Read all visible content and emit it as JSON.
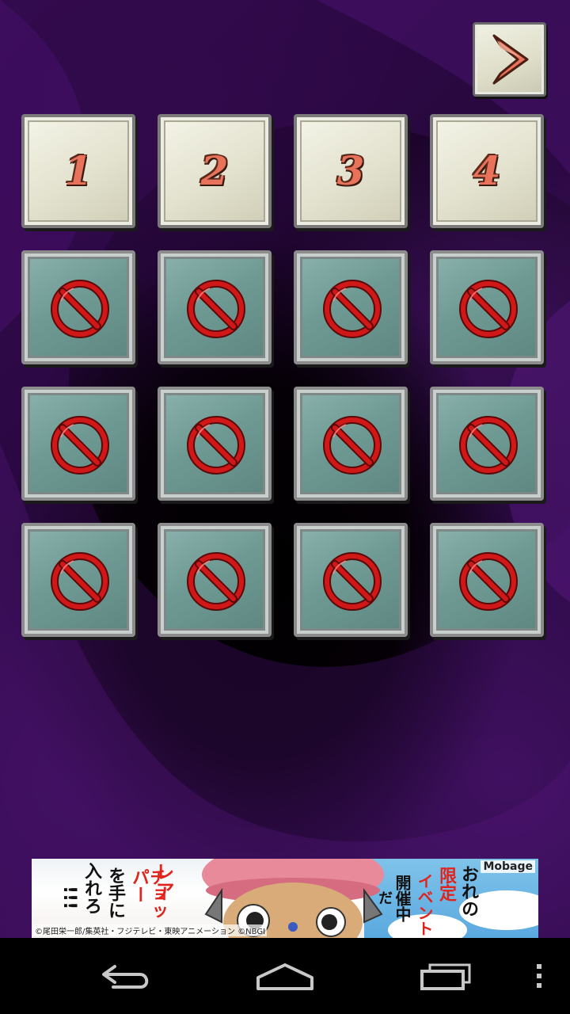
{
  "screen": {
    "background_color": "#2a0a3e"
  },
  "next_button": {
    "icon": "chevron-right-icon",
    "color": "#e8735a"
  },
  "stages": [
    {
      "label": "1",
      "state": "unlocked"
    },
    {
      "label": "2",
      "state": "unlocked"
    },
    {
      "label": "3",
      "state": "unlocked"
    },
    {
      "label": "4",
      "state": "unlocked"
    },
    {
      "label": "",
      "state": "locked"
    },
    {
      "label": "",
      "state": "locked"
    },
    {
      "label": "",
      "state": "locked"
    },
    {
      "label": "",
      "state": "locked"
    },
    {
      "label": "",
      "state": "locked"
    },
    {
      "label": "",
      "state": "locked"
    },
    {
      "label": "",
      "state": "locked"
    },
    {
      "label": "",
      "state": "locked"
    },
    {
      "label": "",
      "state": "locked"
    },
    {
      "label": "",
      "state": "locked"
    },
    {
      "label": "",
      "state": "locked"
    },
    {
      "label": "",
      "state": "locked"
    }
  ],
  "colors": {
    "unlocked_tile": "#e3e2cf",
    "locked_tile": "#6f9a94",
    "lock_icon": "#d01818",
    "number": "#e8735a"
  },
  "ad": {
    "brand": "Mobage",
    "left_col1": "入れろ",
    "left_col2": "を手に",
    "left_col3": "チョッパー",
    "left_col4": "レア",
    "left_exclaim": "!!!",
    "right_col1": "おれの",
    "right_col2": "限定",
    "right_col3": "イベント",
    "right_col4": "開催中",
    "right_col5": "だ",
    "copyright": "©尾田栄一郎/集英社・フジテレビ・東映アニメーション ©NBGI"
  },
  "navbar": {
    "back_icon": "back-arrow-icon",
    "home_icon": "home-icon",
    "recents_icon": "recent-apps-icon",
    "menu_icon": "overflow-menu-icon"
  }
}
